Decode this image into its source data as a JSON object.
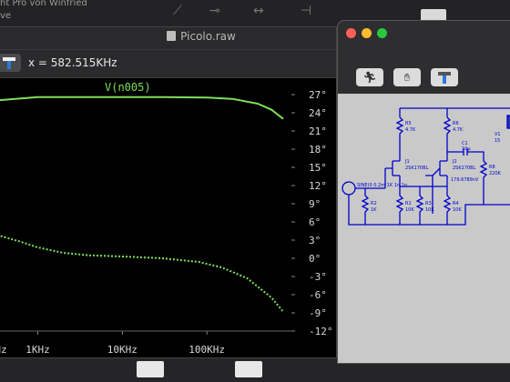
{
  "background": {
    "header_line1": "ht Pro von Winfried",
    "header_line2": "ve"
  },
  "plot_window": {
    "title": "Picolo.raw",
    "cursor_readout": "x = 582.515KHz",
    "trace_label": "V(n005)",
    "probe_icon": "probe-hammer-icon",
    "y_ticks": [
      "27°",
      "24°",
      "21°",
      "18°",
      "15°",
      "12°",
      "9°",
      "6°",
      "3°",
      "0°",
      "-3°",
      "-6°",
      "-9°",
      "-12°"
    ],
    "x_ticks": [
      "Hz",
      "1KHz",
      "10KHz",
      "100KHz"
    ]
  },
  "schematic_window": {
    "traffic_lights": [
      "#ff5f57",
      "#febc2e",
      "#28c840"
    ],
    "tools": [
      "run-icon",
      "pan-hand-icon",
      "probe-hammer-icon"
    ],
    "labels": {
      "r5": "R5",
      "r5v": "4.7K",
      "r6": "R6",
      "r6v": "4.7K",
      "r8": "R8",
      "r8v": "220K",
      "c1": "C1",
      "c1v": "10μ",
      "j1": "J1",
      "j1v": "2SK170BL",
      "j2": "J2",
      "j2v": "2SK170BL",
      "r1": "R1",
      "r1v": "10K",
      "r2": "R2",
      "r2v": "1K",
      "r3": "R3",
      "r3v": "10K",
      "r4": "R4",
      "r4v": "10K",
      "source": "SINE(0 0.2m 1K 1n 1n",
      "meas": "179.6789nV",
      "vcc": "V1",
      "vcc_val": "15"
    }
  },
  "chart_data": {
    "type": "line",
    "title": "",
    "trace": "V(n005)",
    "x_scale": "log",
    "xlim": [
      300,
      1000000
    ],
    "ylim": [
      -12,
      27
    ],
    "ylabel_unit": "degrees",
    "series": [
      {
        "name": "V(n005)",
        "style": "solid",
        "color": "#7ee05a",
        "x": [
          300,
          1000,
          3000,
          10000,
          30000,
          100000,
          200000,
          400000,
          582515,
          800000
        ],
        "y": [
          26.0,
          26.6,
          26.6,
          26.6,
          26.6,
          26.5,
          26.3,
          25.5,
          24.5,
          23.0
        ]
      },
      {
        "name": "V(n005) phase",
        "style": "dotted",
        "color": "#7ee05a",
        "x": [
          300,
          600,
          1000,
          2000,
          4000,
          10000,
          30000,
          80000,
          150000,
          300000,
          582515,
          800000
        ],
        "y": [
          4.0,
          2.8,
          1.8,
          0.9,
          0.5,
          0.3,
          0.0,
          -0.6,
          -1.5,
          -3.3,
          -6.5,
          -8.8
        ]
      }
    ]
  }
}
